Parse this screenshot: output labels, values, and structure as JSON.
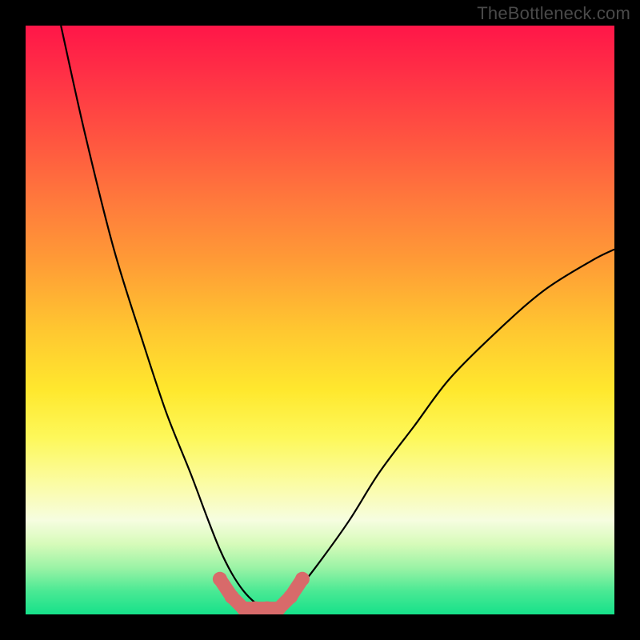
{
  "watermark": "TheBottleneck.com",
  "chart_data": {
    "type": "line",
    "title": "",
    "xlabel": "",
    "ylabel": "",
    "xlim": [
      0,
      100
    ],
    "ylim": [
      0,
      100
    ],
    "grid": false,
    "series": [
      {
        "name": "bottleneck-curve",
        "x": [
          6,
          10,
          15,
          20,
          24,
          28,
          31,
          33,
          35,
          37,
          39,
          41,
          43,
          46,
          50,
          55,
          60,
          66,
          72,
          80,
          88,
          96,
          100
        ],
        "y": [
          100,
          82,
          62,
          46,
          34,
          24,
          16,
          11,
          7,
          4,
          2,
          1,
          2,
          4,
          9,
          16,
          24,
          32,
          40,
          48,
          55,
          60,
          62
        ],
        "color": "#000000"
      }
    ],
    "highlight_region": {
      "name": "optimal-range-markers",
      "x": [
        33,
        35,
        37,
        39,
        41,
        43,
        45,
        47
      ],
      "y": [
        6,
        3,
        1,
        1,
        1,
        1,
        3,
        6
      ],
      "color": "#d86a6a"
    },
    "background": {
      "type": "vertical-gradient",
      "stops": [
        {
          "pos": 0,
          "color": "#ff1648"
        },
        {
          "pos": 30,
          "color": "#ff7a3c"
        },
        {
          "pos": 60,
          "color": "#ffe82e"
        },
        {
          "pos": 85,
          "color": "#d7fbba"
        },
        {
          "pos": 100,
          "color": "#16e18a"
        }
      ]
    }
  }
}
